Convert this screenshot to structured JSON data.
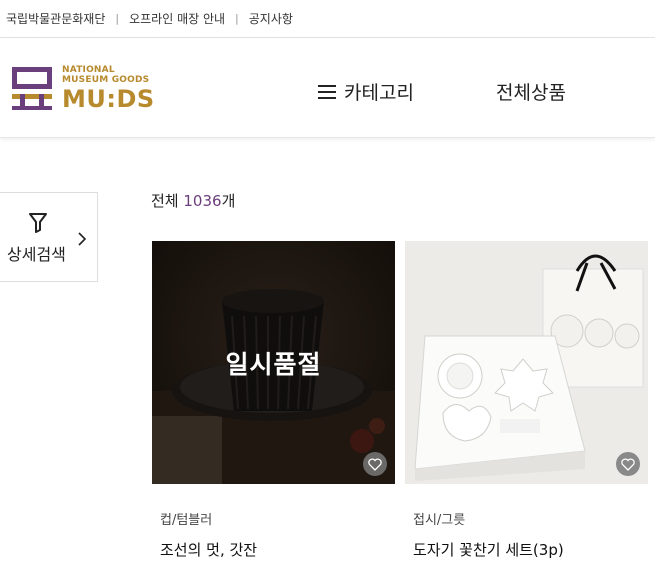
{
  "topbar": {
    "links": [
      "국립박물관문화재단",
      "오프라인 매장 안내",
      "공지사항"
    ],
    "separator": "|"
  },
  "logo": {
    "line1": "NATIONAL",
    "line2": "MUSEUM GOODS",
    "brand": "MU:DS",
    "color": "#b88a2e",
    "mark_color": "#6b3e7c"
  },
  "nav": {
    "category": "카테고리",
    "all_products": "전체상품"
  },
  "filter": {
    "label": "상세검색"
  },
  "listing": {
    "total_label": "전체",
    "total_count": "1036",
    "total_unit": "개"
  },
  "products": [
    {
      "category": "컵/텀블러",
      "name": "조선의 멋, 갓잔",
      "badge": "일시품절"
    },
    {
      "category": "접시/그릇",
      "name": "도자기 꽃찬기 세트(3p)"
    }
  ]
}
